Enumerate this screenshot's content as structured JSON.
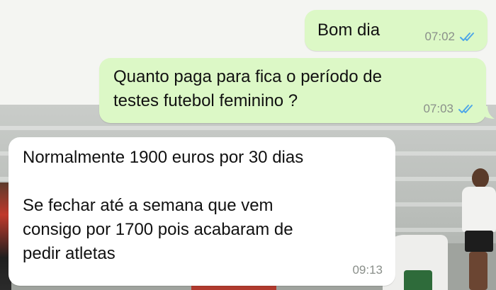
{
  "chat": {
    "messages": [
      {
        "direction": "outgoing",
        "text": "Bom dia",
        "time": "07:02",
        "status": "read",
        "status_icon": "double-check-icon",
        "status_color": "#4fa7e8"
      },
      {
        "direction": "outgoing",
        "text": "Quanto paga para fica o período de\ntestes futebol feminino ?",
        "time": "07:03",
        "status": "read",
        "status_icon": "double-check-icon",
        "status_color": "#4fa7e8"
      },
      {
        "direction": "incoming",
        "text": "Normalmente 1900 euros por 30 dias\n\nSe fechar até a semana que vem\nconsigo por 1700 pois acabaram de\npedir atletas",
        "time": "09:13"
      }
    ]
  },
  "colors": {
    "outgoing_bubble": "#dcf8c6",
    "incoming_bubble": "#ffffff",
    "timestamp": "#8a8f8a",
    "read_ticks": "#4fa7e8"
  }
}
